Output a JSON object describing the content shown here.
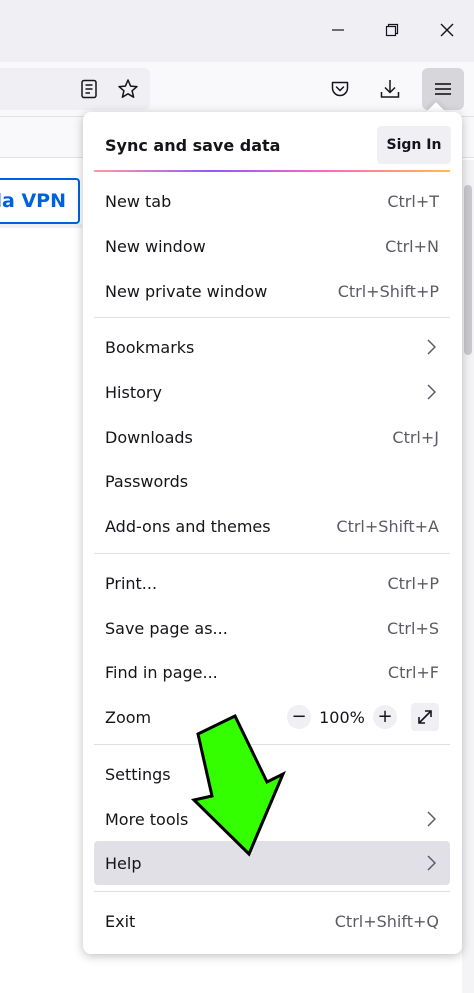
{
  "toolbar": {
    "vpn_fragment": "lla VPN"
  },
  "menu": {
    "sync_title": "Sync and save data",
    "sign_in": "Sign In",
    "items": [
      {
        "label": "New tab",
        "shortcut": "Ctrl+T"
      },
      {
        "label": "New window",
        "shortcut": "Ctrl+N"
      },
      {
        "label": "New private window",
        "shortcut": "Ctrl+Shift+P"
      },
      {
        "label": "Bookmarks",
        "shortcut": ""
      },
      {
        "label": "History",
        "shortcut": ""
      },
      {
        "label": "Downloads",
        "shortcut": "Ctrl+J"
      },
      {
        "label": "Passwords",
        "shortcut": ""
      },
      {
        "label": "Add-ons and themes",
        "shortcut": "Ctrl+Shift+A"
      },
      {
        "label": "Print...",
        "shortcut": "Ctrl+P"
      },
      {
        "label": "Save page as...",
        "shortcut": "Ctrl+S"
      },
      {
        "label": "Find in page...",
        "shortcut": "Ctrl+F"
      },
      {
        "label": "Zoom",
        "shortcut": ""
      },
      {
        "label": "Settings",
        "shortcut": ""
      },
      {
        "label": "More tools",
        "shortcut": ""
      },
      {
        "label": "Help",
        "shortcut": ""
      },
      {
        "label": "Exit",
        "shortcut": "Ctrl+Shift+Q"
      }
    ],
    "zoom": {
      "minus": "−",
      "value": "100%",
      "plus": "+"
    }
  },
  "colors": {
    "accent": "#0060df",
    "annotation_arrow": "#33ff00"
  }
}
